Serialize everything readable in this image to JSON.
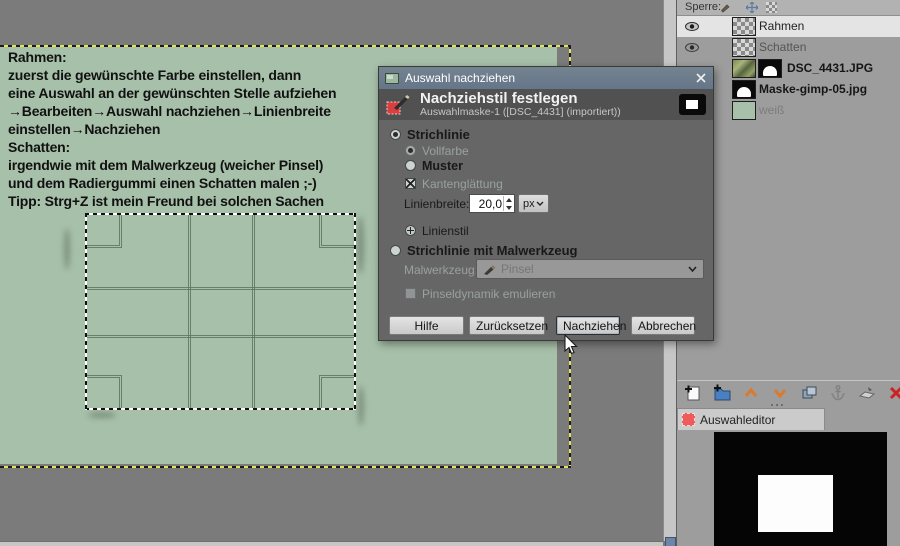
{
  "canvas": {
    "instructions": [
      "Rahmen:",
      "zuerst die gewünschte Farbe einstellen, dann",
      "eine Auswahl an der gewünschten Stelle aufziehen",
      "→Bearbeiten→Auswahl nachziehen→Linienbreite",
      "einstellen→Nachziehen",
      "Schatten:",
      "irgendwie mit dem Malwerkzeug (weicher Pinsel)",
      "und dem Radiergummi einen Schatten malen ;-)",
      "Tipp: Strg+Z ist mein Freund bei solchen Sachen"
    ]
  },
  "dialog": {
    "title": "Auswahl nachziehen",
    "header_title": "Nachziehstil festlegen",
    "header_subtitle": "Auswahlmaske-1 ([DSC_4431] (importiert))",
    "fields": {
      "strichlinie": "Strichlinie",
      "vollfarbe": "Vollfarbe",
      "muster": "Muster",
      "kantenglaettung": "Kantenglättung",
      "linienbreite_label": "Linienbreite:",
      "linienbreite_value": "20,0",
      "unit": "px",
      "linienstil": "Linienstil",
      "strichlinie_mit_malwerkzeug": "Strichlinie mit Malwerkzeug",
      "malwerkzeug_label": "Malwerkzeug:",
      "malwerkzeug_value": "Pinsel",
      "pinseldynamik": "Pinseldynamik emulieren"
    },
    "buttons": [
      "Hilfe",
      "Zurücksetzen",
      "Nachziehen",
      "Abbrechen"
    ]
  },
  "dock": {
    "lock_label": "Sperre:",
    "layers": [
      {
        "name": "Rahmen"
      },
      {
        "name": "Schatten"
      },
      {
        "name": "DSC_4431.JPG"
      },
      {
        "name": "Maske-gimp-05.jpg"
      },
      {
        "name": "weiß"
      }
    ],
    "selection_editor_tab": "Auswahleditor"
  },
  "colors": {
    "canvas_green": "#a7c0a9",
    "titlebar_blue": "#6b7a8b",
    "accent_orange": "#d97a2e",
    "selection_red": "#ef5a5a",
    "layer_boundary_yellow": "#e3e35a"
  }
}
